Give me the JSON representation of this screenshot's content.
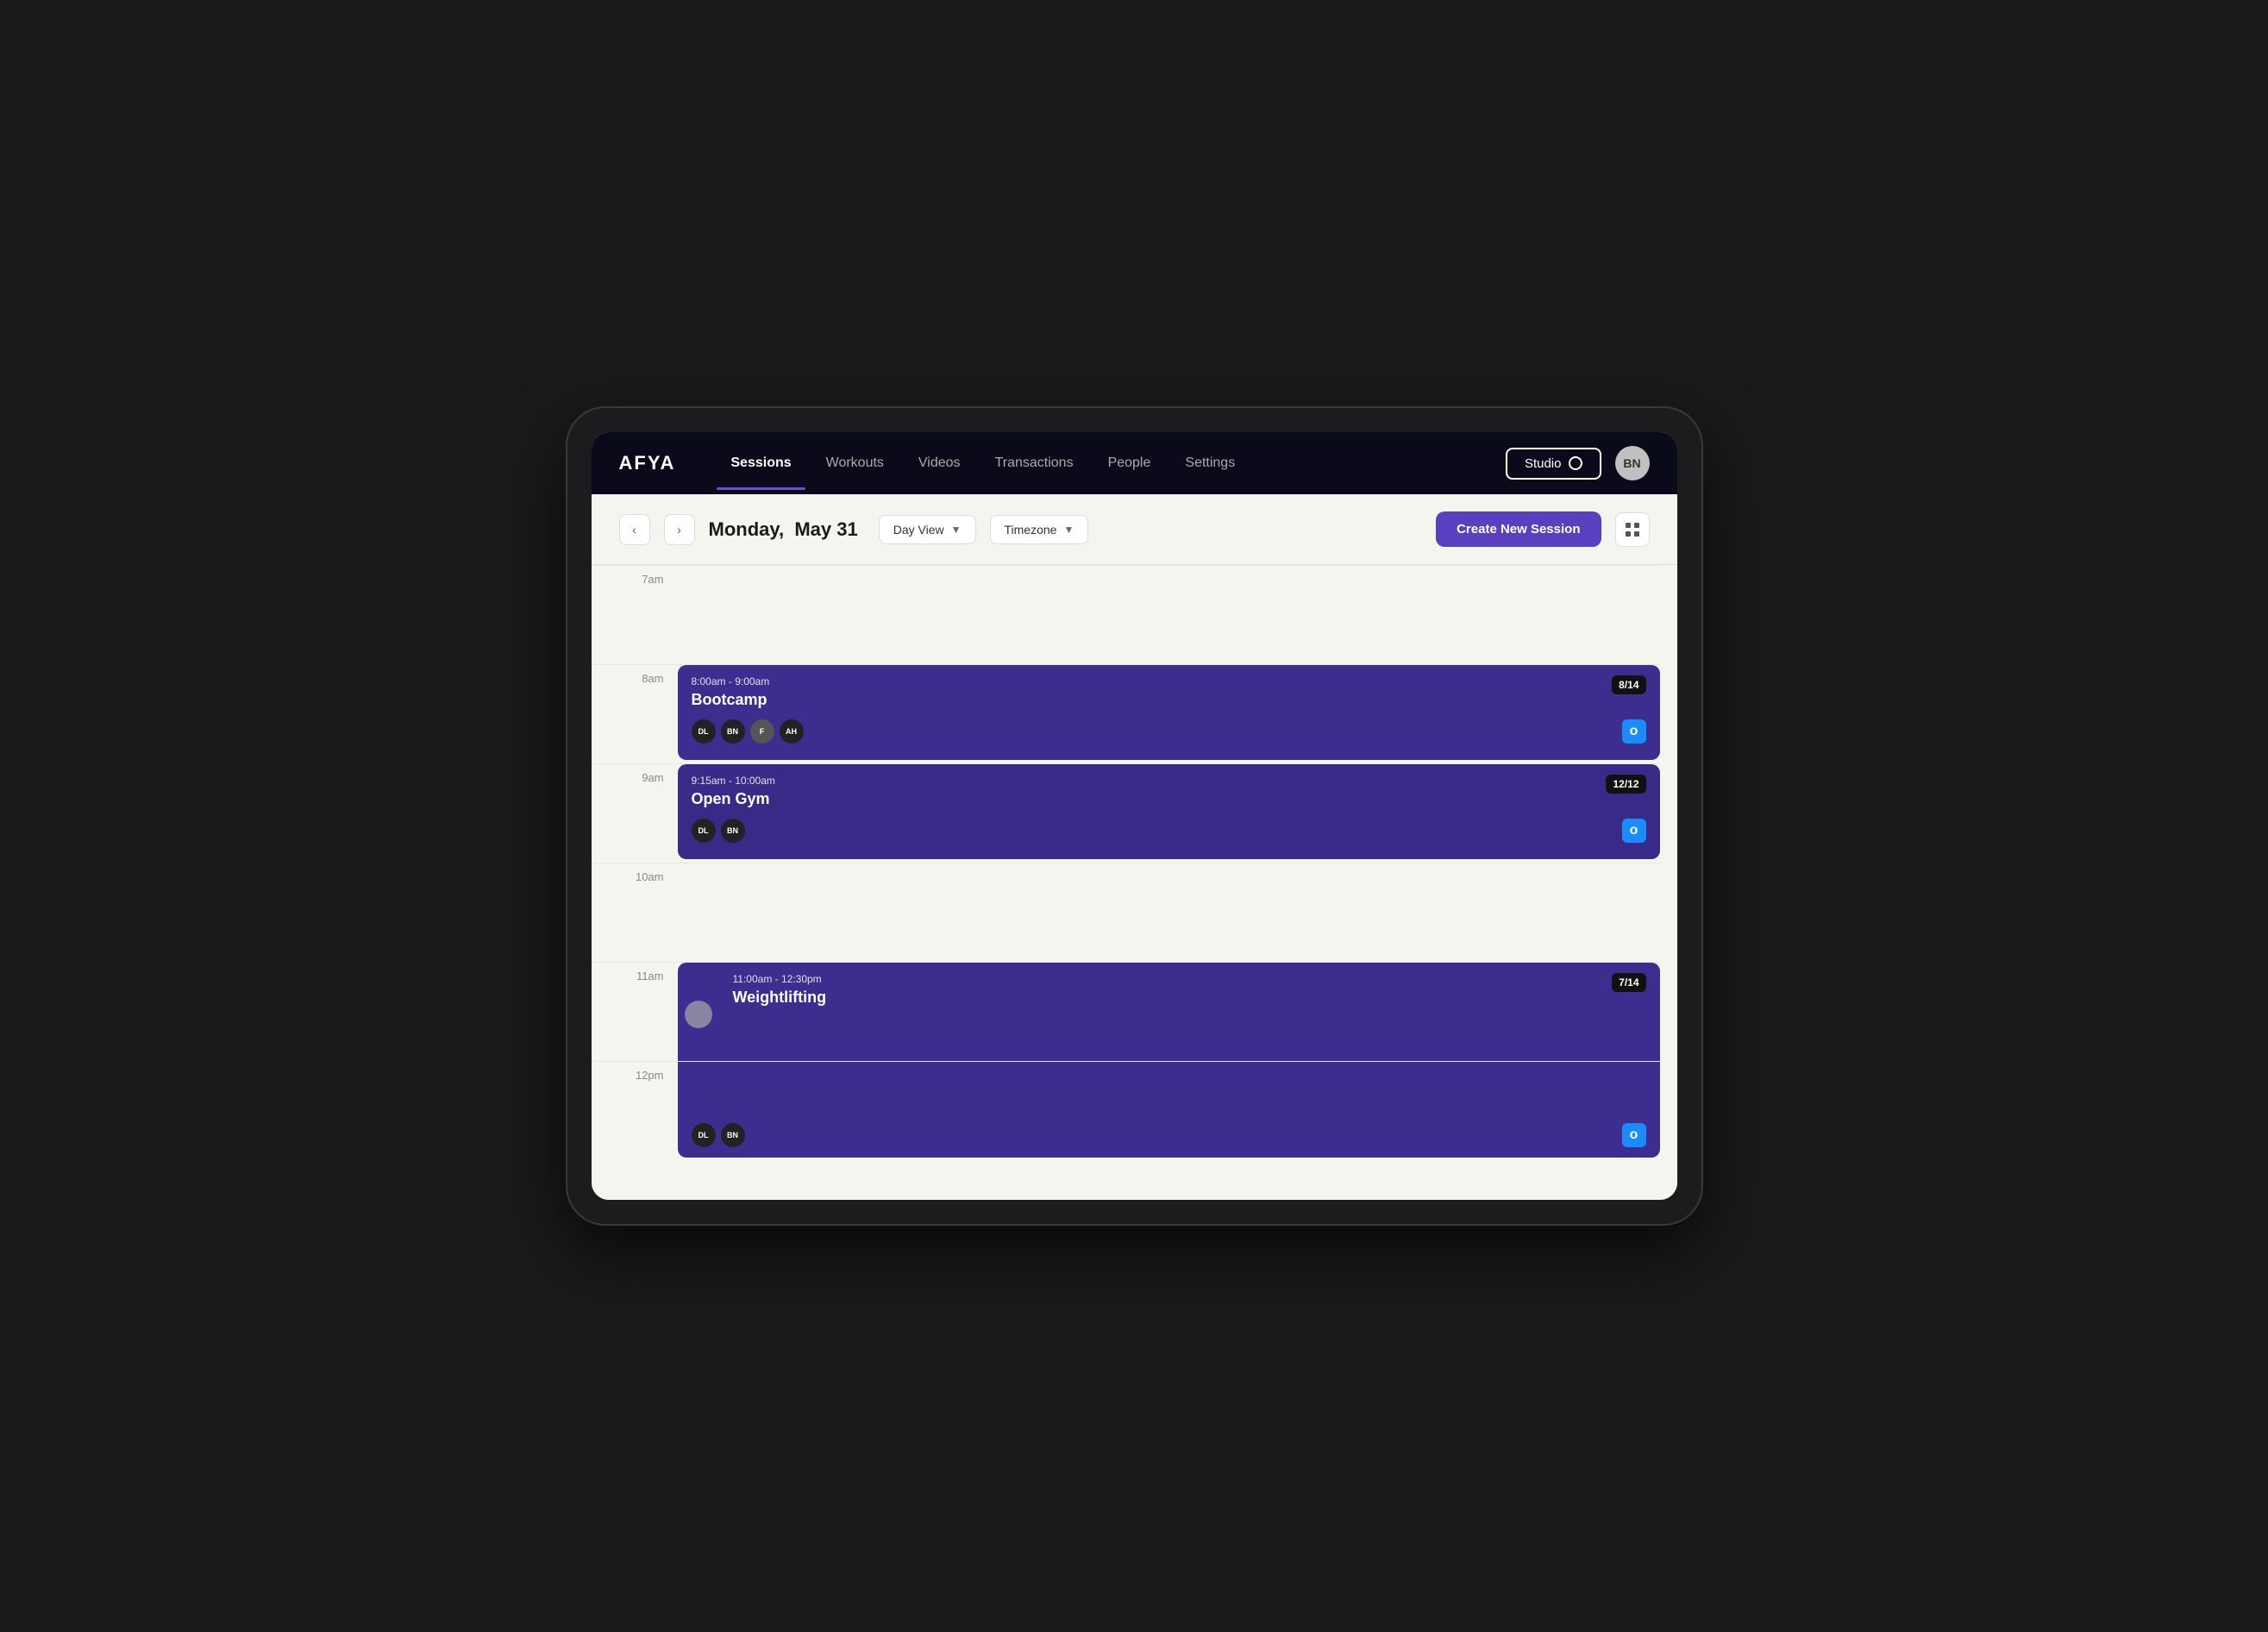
{
  "app": {
    "logo": "AFYA",
    "avatar_initials": "BN"
  },
  "nav": {
    "links": [
      {
        "id": "sessions",
        "label": "Sessions",
        "active": true
      },
      {
        "id": "workouts",
        "label": "Workouts",
        "active": false
      },
      {
        "id": "videos",
        "label": "Videos",
        "active": false
      },
      {
        "id": "transactions",
        "label": "Transactions",
        "active": false
      },
      {
        "id": "people",
        "label": "People",
        "active": false
      },
      {
        "id": "settings",
        "label": "Settings",
        "active": false
      }
    ],
    "studio_label": "Studio",
    "avatar_initials": "BN"
  },
  "toolbar": {
    "date_bold": "Monday,",
    "date_rest": "May 31",
    "day_view_label": "Day View",
    "timezone_label": "Timezone",
    "create_btn_label": "Create New Session"
  },
  "time_slots": [
    "7am",
    "8am",
    "9am",
    "10am",
    "11am",
    "12pm"
  ],
  "sessions": [
    {
      "id": "bootcamp",
      "time": "8:00am - 9:00am",
      "name": "Bootcamp",
      "capacity": "8/14",
      "slot": "8am",
      "avatars": [
        "DL",
        "BN",
        "F",
        "AH"
      ]
    },
    {
      "id": "opengym",
      "time": "9:15am - 10:00am",
      "name": "Open Gym",
      "capacity": "12/12",
      "slot": "9am",
      "avatars": [
        "DL",
        "BN"
      ]
    },
    {
      "id": "weightlifting",
      "time": "11:00am - 12:30pm",
      "name": "Weightlifting",
      "capacity": "7/14",
      "slot": "11am",
      "avatars": [
        "DL",
        "BN"
      ]
    }
  ]
}
